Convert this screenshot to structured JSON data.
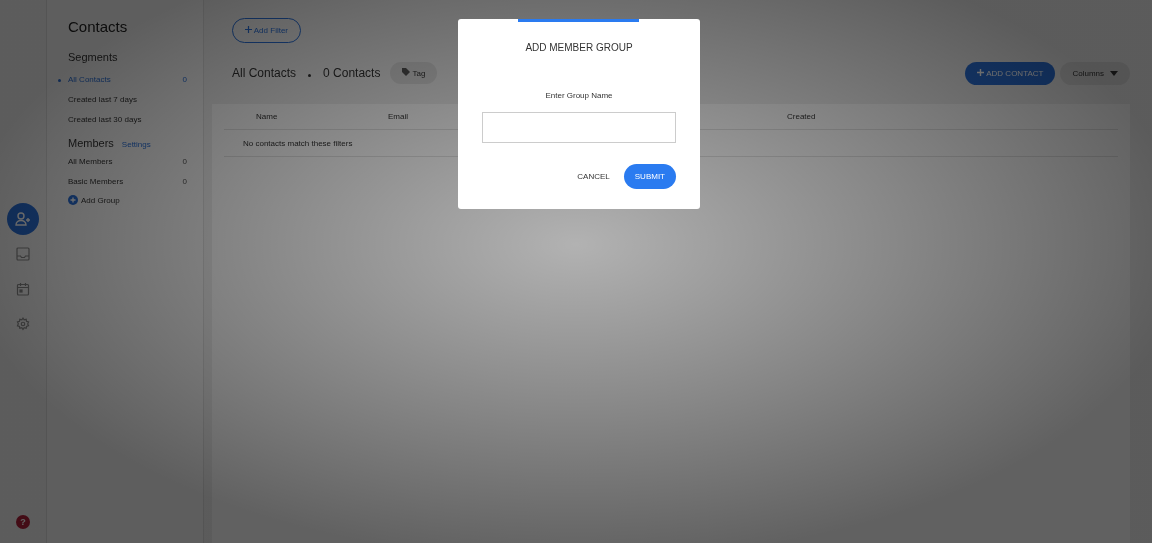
{
  "rail": {
    "items": [
      {
        "kind": "contacts",
        "selected": true
      },
      {
        "kind": "inbox",
        "selected": false
      },
      {
        "kind": "calendar",
        "selected": false
      },
      {
        "kind": "settings",
        "selected": false
      }
    ],
    "help": "?"
  },
  "sidebar": {
    "title": "Contacts",
    "segments_heading": "Segments",
    "segments": [
      {
        "label": "All Contacts",
        "count": "0",
        "selected": true
      },
      {
        "label": "Created last 7 days",
        "selected": false
      },
      {
        "label": "Created last 30 days",
        "selected": false
      }
    ],
    "members_heading": "Members",
    "settings_link": "Settings",
    "members": [
      {
        "label": "All Members",
        "count": "0",
        "selected": false
      },
      {
        "label": "Basic Members",
        "count": "0",
        "selected": false
      }
    ],
    "add_group": "Add Group"
  },
  "main": {
    "add_filter": "Add Filter",
    "view_title": "All Contacts",
    "contact_count": "0 Contacts",
    "tag_button": "Tag",
    "add_contact": "ADD CONTACT",
    "columns_button": "Columns",
    "table": {
      "columns": [
        "Name",
        "Email",
        "Created"
      ],
      "empty_message": "No contacts match these filters"
    }
  },
  "dialog": {
    "title": "ADD MEMBER GROUP",
    "field_label": "Enter Group Name",
    "buttons": [
      {
        "label": "CANCEL",
        "kind": "text"
      },
      {
        "label": "SUBMIT",
        "kind": "primary"
      }
    ]
  }
}
